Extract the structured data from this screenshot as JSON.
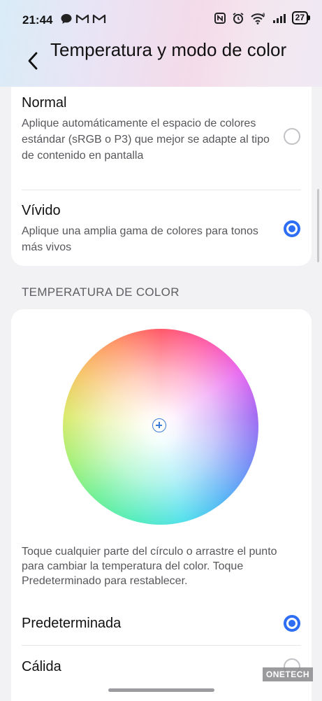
{
  "status_bar": {
    "time": "21:44",
    "battery": "27",
    "left_icons": [
      "message-icon",
      "gmail-icon",
      "gmail-icon"
    ],
    "right_icons": [
      "nfc-icon",
      "alarm-icon",
      "wifi-6-icon",
      "signal-icon"
    ]
  },
  "header": {
    "title": "Temperatura y modo de color",
    "back_icon": "chevron-left-icon"
  },
  "color_mode": {
    "options": [
      {
        "title": "Normal",
        "description": "Aplique automáticamente el espacio de colores estándar (sRGB o P3) que mejor se adapte al tipo de contenido en pantalla",
        "selected": false
      },
      {
        "title": "Vívido",
        "description": "Aplique una amplia gama de colores para tonos más vivos",
        "selected": true
      }
    ]
  },
  "temperature": {
    "section_label": "TEMPERATURA DE COLOR",
    "help_text": "Toque cualquier parte del círculo o arrastre el punto para cambiar la temperatura del color. Toque Predeterminado para restablecer.",
    "presets": [
      {
        "title": "Predeterminada",
        "selected": true
      },
      {
        "title": "Cálida",
        "selected": false
      }
    ]
  },
  "watermark": "ONETECH",
  "colors": {
    "accent": "#2e6ef4",
    "background": "#f2f2f4",
    "card": "#ffffff"
  }
}
